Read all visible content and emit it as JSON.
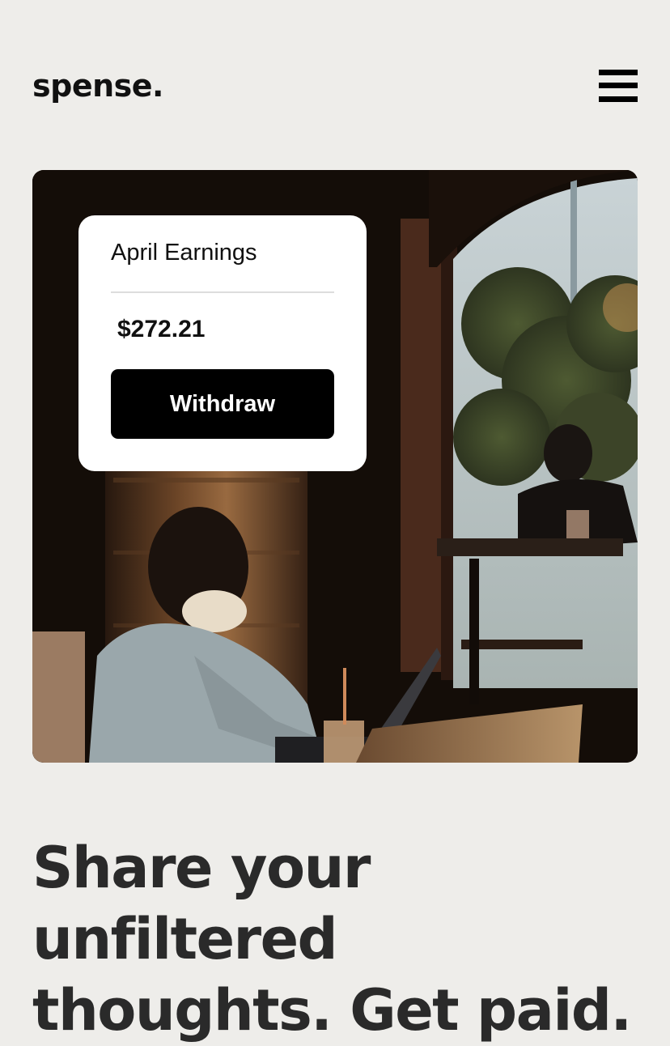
{
  "header": {
    "logo": "spense.",
    "menu_icon": "hamburger-menu-icon"
  },
  "earnings_card": {
    "title": "April Earnings",
    "amount": "$272.21",
    "button_label": "Withdraw"
  },
  "hero": {
    "headline_line1": "Share your unfiltered",
    "headline_line2": "thoughts. Get paid."
  },
  "colors": {
    "background": "#EEEDEA",
    "button": "#000000",
    "card": "#FFFFFF",
    "headline": "#2A2A2A"
  }
}
